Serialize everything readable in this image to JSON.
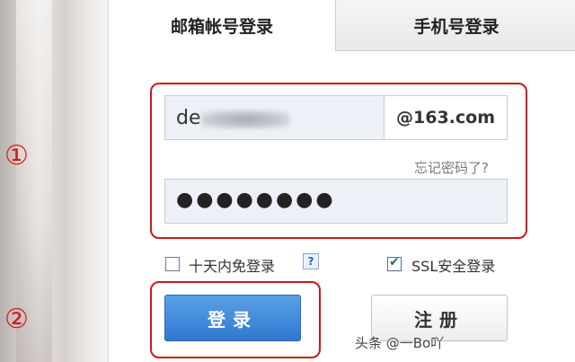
{
  "tabs": {
    "email_login": "邮箱帐号登录",
    "phone_login": "手机号登录"
  },
  "annotations": {
    "marker_1": "①",
    "marker_2": "②"
  },
  "account": {
    "value_visible": "de",
    "domain": "@163.com"
  },
  "forgot_password": "忘记密码了?",
  "password": {
    "masked_value": "●●●●●●●●"
  },
  "options": {
    "remember_label": "十天内免登录",
    "remember_checked": false,
    "help_icon": "?",
    "ssl_label": "SSL安全登录",
    "ssl_checked": true,
    "ssl_check_glyph": "✔"
  },
  "buttons": {
    "login": "登录",
    "register": "注册"
  },
  "watermark": "头条 @一Bo吖",
  "colors": {
    "accent_blue": "#2f78cf",
    "annotation_red": "#c8191b",
    "input_bg": "#edf1f7"
  }
}
